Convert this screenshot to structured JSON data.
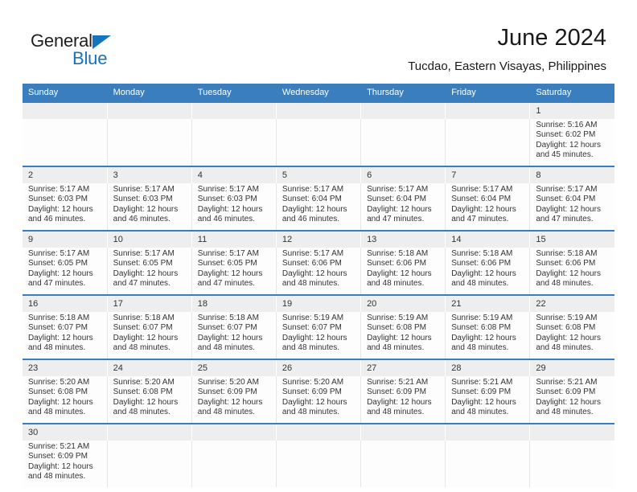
{
  "brand": {
    "name_part1": "General",
    "name_part2": "Blue",
    "triangle_color": "#1574bb"
  },
  "header": {
    "title": "June 2024",
    "subtitle": "Tucdao, Eastern Visayas, Philippines"
  },
  "theme": {
    "header_blue": "#3b7ebd",
    "daynum_band": "#eeeeee",
    "cell_bg": "#fdfdfd",
    "text": "#333333"
  },
  "calendar": {
    "weekday_headers": [
      "Sunday",
      "Monday",
      "Tuesday",
      "Wednesday",
      "Thursday",
      "Friday",
      "Saturday"
    ],
    "weeks": [
      [
        {
          "day": "",
          "lines": []
        },
        {
          "day": "",
          "lines": []
        },
        {
          "day": "",
          "lines": []
        },
        {
          "day": "",
          "lines": []
        },
        {
          "day": "",
          "lines": []
        },
        {
          "day": "",
          "lines": []
        },
        {
          "day": "1",
          "lines": [
            "Sunrise: 5:16 AM",
            "Sunset: 6:02 PM",
            "Daylight: 12 hours",
            "and 45 minutes."
          ]
        }
      ],
      [
        {
          "day": "2",
          "lines": [
            "Sunrise: 5:17 AM",
            "Sunset: 6:03 PM",
            "Daylight: 12 hours",
            "and 46 minutes."
          ]
        },
        {
          "day": "3",
          "lines": [
            "Sunrise: 5:17 AM",
            "Sunset: 6:03 PM",
            "Daylight: 12 hours",
            "and 46 minutes."
          ]
        },
        {
          "day": "4",
          "lines": [
            "Sunrise: 5:17 AM",
            "Sunset: 6:03 PM",
            "Daylight: 12 hours",
            "and 46 minutes."
          ]
        },
        {
          "day": "5",
          "lines": [
            "Sunrise: 5:17 AM",
            "Sunset: 6:04 PM",
            "Daylight: 12 hours",
            "and 46 minutes."
          ]
        },
        {
          "day": "6",
          "lines": [
            "Sunrise: 5:17 AM",
            "Sunset: 6:04 PM",
            "Daylight: 12 hours",
            "and 47 minutes."
          ]
        },
        {
          "day": "7",
          "lines": [
            "Sunrise: 5:17 AM",
            "Sunset: 6:04 PM",
            "Daylight: 12 hours",
            "and 47 minutes."
          ]
        },
        {
          "day": "8",
          "lines": [
            "Sunrise: 5:17 AM",
            "Sunset: 6:04 PM",
            "Daylight: 12 hours",
            "and 47 minutes."
          ]
        }
      ],
      [
        {
          "day": "9",
          "lines": [
            "Sunrise: 5:17 AM",
            "Sunset: 6:05 PM",
            "Daylight: 12 hours",
            "and 47 minutes."
          ]
        },
        {
          "day": "10",
          "lines": [
            "Sunrise: 5:17 AM",
            "Sunset: 6:05 PM",
            "Daylight: 12 hours",
            "and 47 minutes."
          ]
        },
        {
          "day": "11",
          "lines": [
            "Sunrise: 5:17 AM",
            "Sunset: 6:05 PM",
            "Daylight: 12 hours",
            "and 47 minutes."
          ]
        },
        {
          "day": "12",
          "lines": [
            "Sunrise: 5:17 AM",
            "Sunset: 6:06 PM",
            "Daylight: 12 hours",
            "and 48 minutes."
          ]
        },
        {
          "day": "13",
          "lines": [
            "Sunrise: 5:18 AM",
            "Sunset: 6:06 PM",
            "Daylight: 12 hours",
            "and 48 minutes."
          ]
        },
        {
          "day": "14",
          "lines": [
            "Sunrise: 5:18 AM",
            "Sunset: 6:06 PM",
            "Daylight: 12 hours",
            "and 48 minutes."
          ]
        },
        {
          "day": "15",
          "lines": [
            "Sunrise: 5:18 AM",
            "Sunset: 6:06 PM",
            "Daylight: 12 hours",
            "and 48 minutes."
          ]
        }
      ],
      [
        {
          "day": "16",
          "lines": [
            "Sunrise: 5:18 AM",
            "Sunset: 6:07 PM",
            "Daylight: 12 hours",
            "and 48 minutes."
          ]
        },
        {
          "day": "17",
          "lines": [
            "Sunrise: 5:18 AM",
            "Sunset: 6:07 PM",
            "Daylight: 12 hours",
            "and 48 minutes."
          ]
        },
        {
          "day": "18",
          "lines": [
            "Sunrise: 5:18 AM",
            "Sunset: 6:07 PM",
            "Daylight: 12 hours",
            "and 48 minutes."
          ]
        },
        {
          "day": "19",
          "lines": [
            "Sunrise: 5:19 AM",
            "Sunset: 6:07 PM",
            "Daylight: 12 hours",
            "and 48 minutes."
          ]
        },
        {
          "day": "20",
          "lines": [
            "Sunrise: 5:19 AM",
            "Sunset: 6:08 PM",
            "Daylight: 12 hours",
            "and 48 minutes."
          ]
        },
        {
          "day": "21",
          "lines": [
            "Sunrise: 5:19 AM",
            "Sunset: 6:08 PM",
            "Daylight: 12 hours",
            "and 48 minutes."
          ]
        },
        {
          "day": "22",
          "lines": [
            "Sunrise: 5:19 AM",
            "Sunset: 6:08 PM",
            "Daylight: 12 hours",
            "and 48 minutes."
          ]
        }
      ],
      [
        {
          "day": "23",
          "lines": [
            "Sunrise: 5:20 AM",
            "Sunset: 6:08 PM",
            "Daylight: 12 hours",
            "and 48 minutes."
          ]
        },
        {
          "day": "24",
          "lines": [
            "Sunrise: 5:20 AM",
            "Sunset: 6:08 PM",
            "Daylight: 12 hours",
            "and 48 minutes."
          ]
        },
        {
          "day": "25",
          "lines": [
            "Sunrise: 5:20 AM",
            "Sunset: 6:09 PM",
            "Daylight: 12 hours",
            "and 48 minutes."
          ]
        },
        {
          "day": "26",
          "lines": [
            "Sunrise: 5:20 AM",
            "Sunset: 6:09 PM",
            "Daylight: 12 hours",
            "and 48 minutes."
          ]
        },
        {
          "day": "27",
          "lines": [
            "Sunrise: 5:21 AM",
            "Sunset: 6:09 PM",
            "Daylight: 12 hours",
            "and 48 minutes."
          ]
        },
        {
          "day": "28",
          "lines": [
            "Sunrise: 5:21 AM",
            "Sunset: 6:09 PM",
            "Daylight: 12 hours",
            "and 48 minutes."
          ]
        },
        {
          "day": "29",
          "lines": [
            "Sunrise: 5:21 AM",
            "Sunset: 6:09 PM",
            "Daylight: 12 hours",
            "and 48 minutes."
          ]
        }
      ],
      [
        {
          "day": "30",
          "lines": [
            "Sunrise: 5:21 AM",
            "Sunset: 6:09 PM",
            "Daylight: 12 hours",
            "and 48 minutes."
          ]
        },
        {
          "day": "",
          "lines": []
        },
        {
          "day": "",
          "lines": []
        },
        {
          "day": "",
          "lines": []
        },
        {
          "day": "",
          "lines": []
        },
        {
          "day": "",
          "lines": []
        },
        {
          "day": "",
          "lines": []
        }
      ]
    ]
  }
}
